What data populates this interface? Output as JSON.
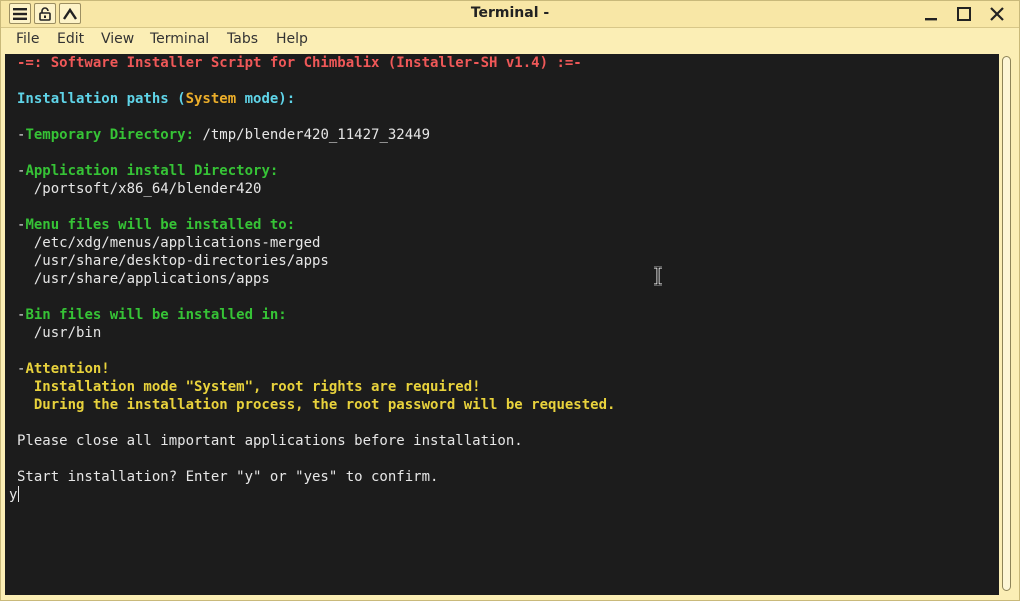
{
  "window": {
    "title": "Terminal -",
    "icons": [
      "menu-icon",
      "lock-icon",
      "up-arrow-icon",
      "minimize-icon",
      "maximize-icon",
      "close-icon"
    ]
  },
  "menu": {
    "file": "File",
    "edit": "Edit",
    "view": "View",
    "terminal": "Terminal",
    "tabs": "Tabs",
    "help": "Help"
  },
  "terminal": {
    "header": "-=: Software Installer Script for Chimbalix (Installer-SH v1.4) :=-",
    "paths_label_a": "Installation paths (",
    "paths_mode": "System",
    "paths_label_b": " mode):",
    "dash": "-",
    "temp_label": "Temporary Directory:",
    "temp_value": " /tmp/blender420_11427_32449",
    "app_label": "Application install Directory:",
    "app_value": "  /portsoft/x86_64/blender420",
    "menu_label": "Menu files will be installed to:",
    "menu_values": [
      "  /etc/xdg/menus/applications-merged",
      "  /usr/share/desktop-directories/apps",
      "  /usr/share/applications/apps"
    ],
    "bin_label": "Bin files will be installed in:",
    "bin_value": "  /usr/bin",
    "attention_label": "Attention!",
    "attention_lines": [
      "  Installation mode \"System\", root rights are required!",
      "  During the installation process, the root password will be requested."
    ],
    "close_apps": "Please close all important applications before installation.",
    "prompt": "Start installation? Enter \"y\" or \"yes\" to confirm.",
    "input": "y"
  },
  "colors": {
    "background": "#1c1c1c",
    "header": "#ef5858",
    "cyan": "#5fd4e8",
    "green": "#36c336",
    "yellow": "#e8d23c",
    "orange": "#ecae2a",
    "text": "#e6e6e6",
    "chrome": "#fbeeb5"
  }
}
